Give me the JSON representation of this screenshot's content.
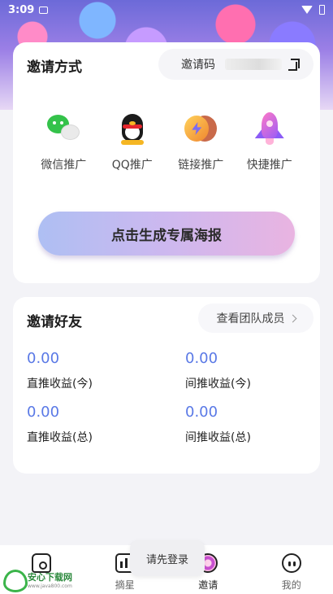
{
  "status_bar": {
    "time": "3:09"
  },
  "invite_methods": {
    "title": "邀请方式",
    "invite_code_label": "邀请码",
    "share_options": [
      {
        "label": "微信推广",
        "icon": "wechat-icon"
      },
      {
        "label": "QQ推广",
        "icon": "qq-icon"
      },
      {
        "label": "链接推广",
        "icon": "link-icon"
      },
      {
        "label": "快捷推广",
        "icon": "rocket-icon"
      }
    ],
    "poster_button": "点击生成专属海报"
  },
  "invite_friends": {
    "title": "邀请好友",
    "team_button": "查看团队成员",
    "stats": [
      {
        "value": "0.00",
        "label": "直推收益(今)"
      },
      {
        "value": "0.00",
        "label": "间推收益(今)"
      },
      {
        "value": "0.00",
        "label": "直推收益(总)"
      },
      {
        "value": "0.00",
        "label": "间推收益(总)"
      }
    ]
  },
  "tabbar": {
    "tabs": [
      {
        "label": "",
        "icon": "home-icon"
      },
      {
        "label": "摘星",
        "icon": "chart-icon"
      },
      {
        "label": "邀请",
        "icon": "invite-icon",
        "active": true
      },
      {
        "label": "我的",
        "icon": "profile-icon"
      }
    ]
  },
  "toast": {
    "message": "请先登录"
  },
  "watermark": {
    "name": "安心下载网",
    "url": "www.java800.com"
  },
  "colors": {
    "accent_value": "#5a79e6",
    "brand_gradient_start": "#aebff3",
    "brand_gradient_end": "#e9b4e1"
  }
}
